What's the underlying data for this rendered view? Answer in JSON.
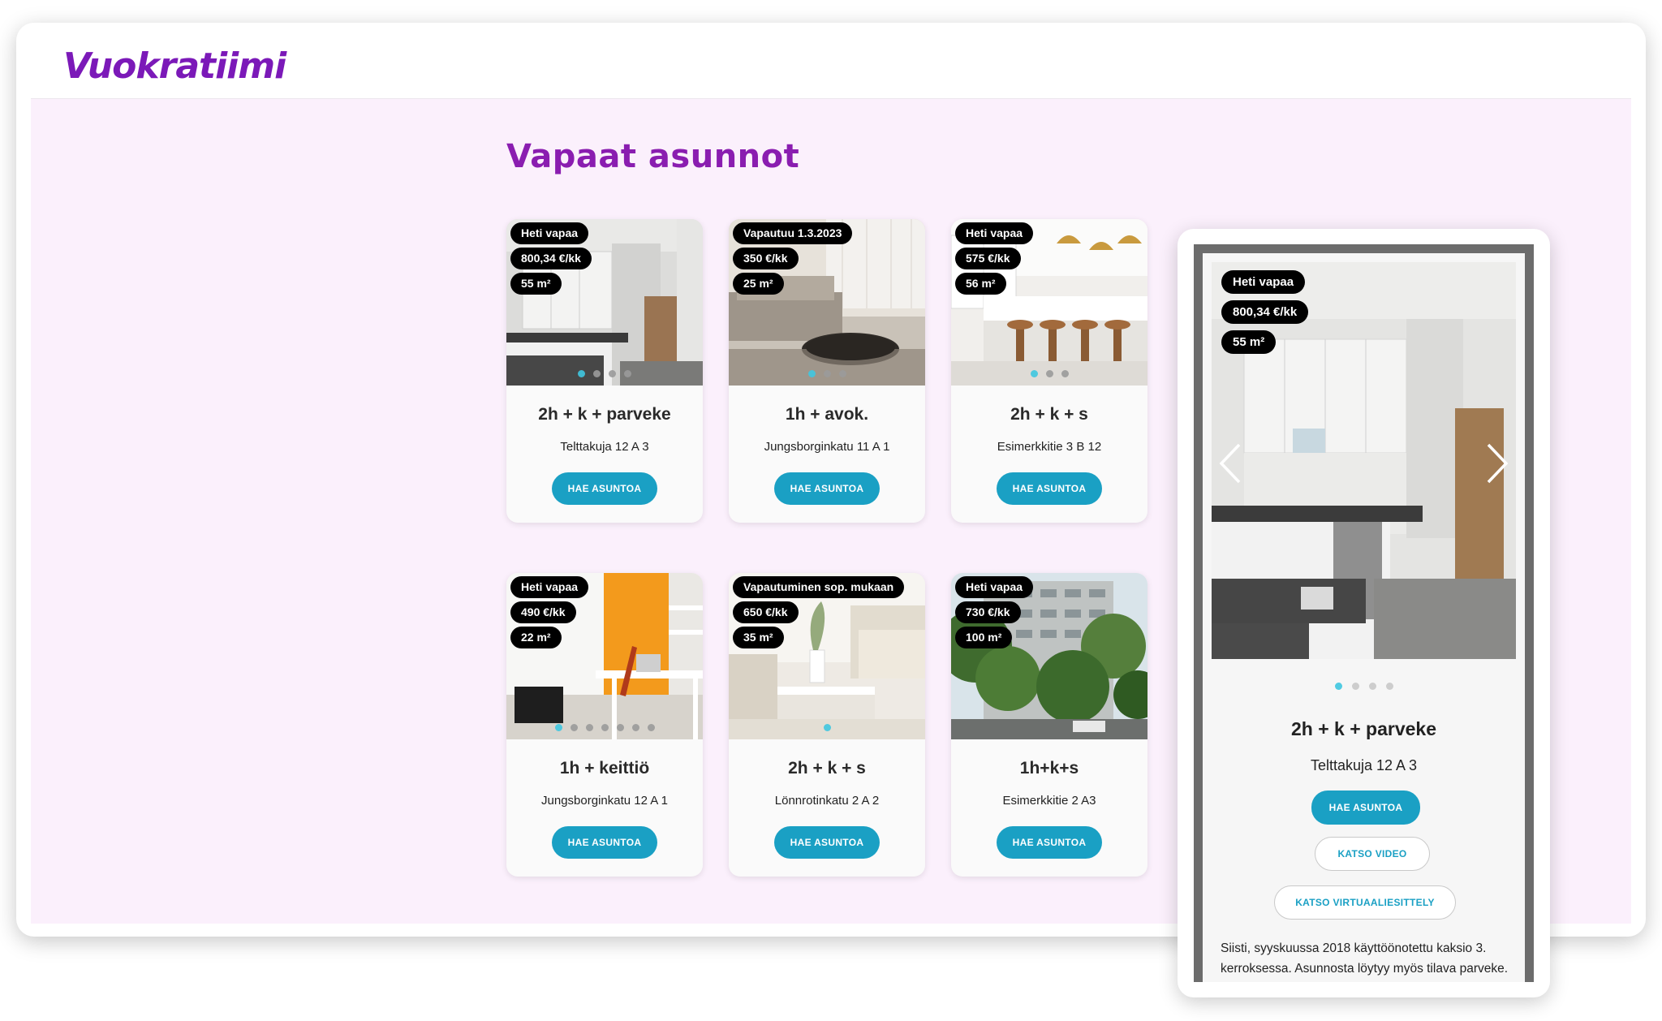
{
  "header": {
    "logo_text": "Vuokratiimi"
  },
  "page": {
    "title": "Vapaat asunnot"
  },
  "listings": [
    {
      "availability": "Heti vapaa",
      "price": "800,34 €/kk",
      "area": "55 m²",
      "title": "2h + k + parveke",
      "address": "Telttakuja 12 A 3",
      "button": "HAE ASUNTOA",
      "image": "kitchen-white-cabinets",
      "dots": 4,
      "active_dot": 0
    },
    {
      "availability": "Vapautuu 1.3.2023",
      "price": "350 €/kk",
      "area": "25 m²",
      "title": "1h + avok.",
      "address": "Jungsborginkatu 11 A 1",
      "button": "HAE ASUNTOA",
      "image": "living-room-sofa",
      "dots": 3,
      "active_dot": 0
    },
    {
      "availability": "Heti vapaa",
      "price": "575 €/kk",
      "area": "56 m²",
      "title": "2h + k + s",
      "address": "Esimerkkitie 3 B 12",
      "button": "HAE ASUNTOA",
      "image": "kitchen-island-stools",
      "dots": 3,
      "active_dot": 0
    },
    {
      "availability": "Heti vapaa",
      "price": "490 €/kk",
      "area": "22 m²",
      "title": "1h + keittiö",
      "address": "Jungsborginkatu 12 A 1",
      "button": "HAE ASUNTOA",
      "image": "studio-orange-wall",
      "dots": 7,
      "active_dot": 0
    },
    {
      "availability": "Vapautuminen sop. mukaan",
      "price": "650 €/kk",
      "area": "35 m²",
      "title": "2h + k + s",
      "address": "Lönnrotinkatu 2 A 2",
      "button": "HAE ASUNTOA",
      "image": "bright-living-room",
      "dots": 1,
      "active_dot": 0
    },
    {
      "availability": "Heti vapaa",
      "price": "730 €/kk",
      "area": "100 m²",
      "title": "1h+k+s",
      "address": "Esimerkkitie 2 A3",
      "button": "HAE ASUNTOA",
      "image": "apartment-building-trees",
      "dots": 0,
      "active_dot": 0
    }
  ],
  "mobile_preview": {
    "availability": "Heti vapaa",
    "price": "800,34 €/kk",
    "area": "55 m²",
    "title": "2h + k + parveke",
    "address": "Telttakuja 12 A 3",
    "apply_button": "HAE ASUNTOA",
    "video_button": "KATSO VIDEO",
    "virtual_button": "KATSO VIRTUAALIESITTELY",
    "description": "Siisti, syyskuussa 2018 käyttöönotettu kaksio 3. kerroksessa. Asunnosta löytyy myös tilava parveke.",
    "dots": 4,
    "active_dot": 0
  },
  "colors": {
    "brand_purple": "#7b19b8",
    "accent_blue": "#1aa0c4",
    "page_background": "#fbf0fc",
    "dot_active": "#3fc6e0"
  }
}
